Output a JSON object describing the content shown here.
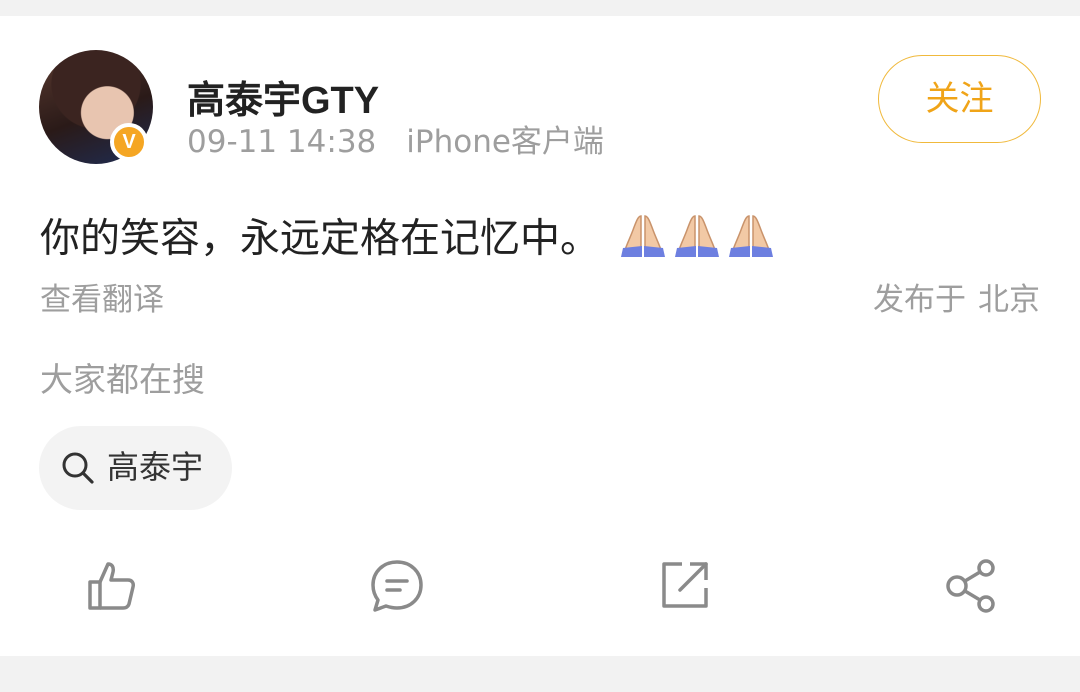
{
  "post": {
    "username": "高泰宇GTY",
    "time": "09-11 14:38",
    "source": "iPhone客户端",
    "follow_label": "关注",
    "text": "你的笑容，永远定格在记忆中。",
    "emoji": "folded-hands-icon x3",
    "translate_label": "查看翻译",
    "location_prefix": "发布于",
    "location_city": "北京"
  },
  "related_search": {
    "heading": "大家都在搜",
    "chip_label": "高泰宇"
  },
  "actions": [
    "like-icon",
    "comment-icon",
    "repost-icon",
    "share-icon"
  ],
  "colors": {
    "accent": "#f0a418",
    "verified_badge": "#f5a623",
    "muted_text": "#9e9e9e",
    "icon_gray": "#8a8a8a"
  }
}
